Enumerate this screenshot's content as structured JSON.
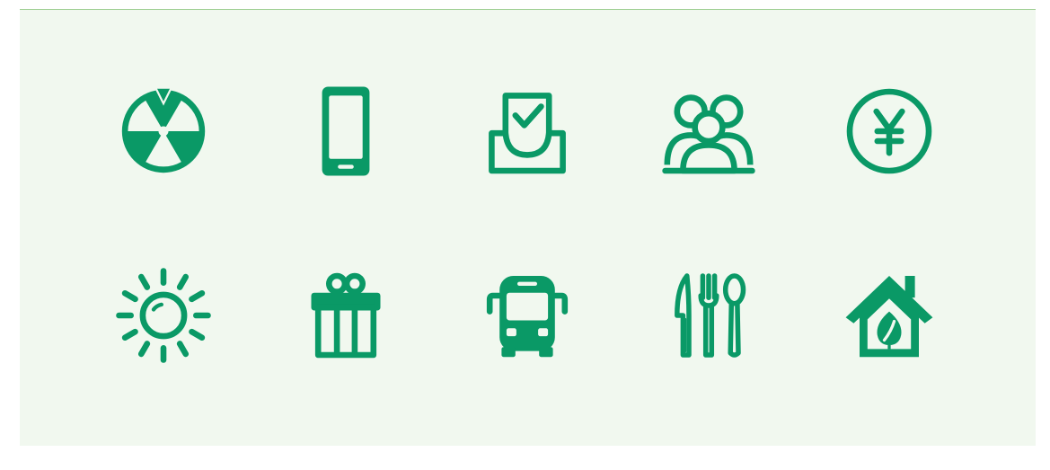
{
  "colors": {
    "icon": "#0a9966",
    "panel": "#f1f8ef",
    "line": "#9fcf93"
  },
  "icons": [
    {
      "name": "prize-wheel-icon"
    },
    {
      "name": "smartphone-icon"
    },
    {
      "name": "inbox-check-icon"
    },
    {
      "name": "user-group-icon"
    },
    {
      "name": "yen-coin-icon"
    },
    {
      "name": "sun-icon"
    },
    {
      "name": "gift-box-icon"
    },
    {
      "name": "bus-icon"
    },
    {
      "name": "knife-fork-spoon-icon"
    },
    {
      "name": "eco-house-icon"
    }
  ]
}
